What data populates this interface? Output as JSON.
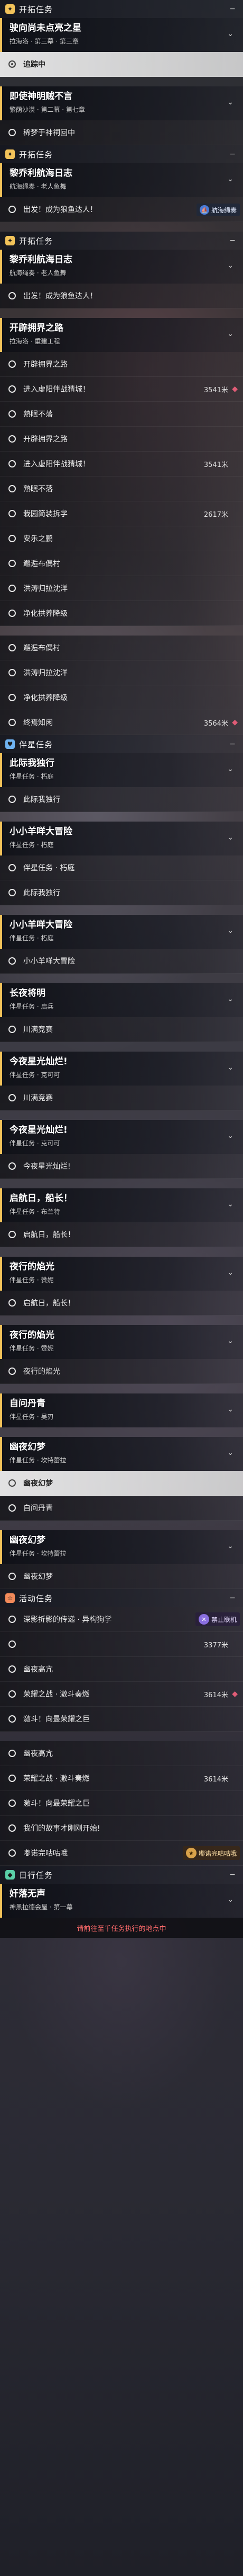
{
  "colors": {
    "main_badge": "#f2c35a",
    "trailblaze_badge": "#f2c35a",
    "companion_badge": "#6fb3f2",
    "event_badge": "#f28a5a",
    "daily_badge": "#5ad0a8",
    "marker": "#e05c76",
    "highlight_row": "#efefef"
  },
  "sections": [
    {
      "type": "cat",
      "badge": "✦",
      "badge_color": "#f2c35a",
      "title": "开拓任务",
      "toggle": "−"
    },
    {
      "type": "mission",
      "title": "驶向尚未点亮之星",
      "sub": "拉海洛 · 第三幕 · 第三章"
    },
    {
      "type": "obj",
      "text": "追踪中",
      "state": "hl",
      "done": true
    },
    {
      "type": "gap"
    },
    {
      "type": "mission",
      "title": "即使神明贼不言",
      "sub": "繁荫沙漠 · 第二幕 · 第七章"
    },
    {
      "type": "obj",
      "text": "稀梦于神祠回中",
      "done": false
    },
    {
      "type": "cat",
      "badge": "✦",
      "badge_color": "#f2c35a",
      "title": "开拓任务",
      "toggle": "−"
    },
    {
      "type": "mission",
      "title": "黎乔利航海日志",
      "sub": "航海绳奏 · 老人鱼舞"
    },
    {
      "type": "obj",
      "text": "出发！成为狼鱼达人！",
      "done": false,
      "tag": "航海绳奏"
    },
    {
      "type": "gap"
    },
    {
      "type": "cat",
      "badge": "✦",
      "badge_color": "#f2c35a",
      "title": "开拓任务",
      "toggle": "−"
    },
    {
      "type": "mission",
      "title": "黎乔利航海日志",
      "sub": "航海绳奏 · 老人鱼舞"
    },
    {
      "type": "obj",
      "text": "出发！成为狼鱼达人！",
      "done": false
    },
    {
      "type": "gap"
    },
    {
      "type": "mission",
      "title": "开辟拥界之路",
      "sub": "拉海洛 · 重建工程"
    },
    {
      "type": "obj",
      "text": "开辟拥界之路",
      "done": false
    },
    {
      "type": "obj",
      "text": "进入虚阳伴战猜城！",
      "dist": "3541米",
      "done": false,
      "marker": true
    },
    {
      "type": "obj",
      "text": "熟眠不落",
      "done": false
    },
    {
      "type": "obj",
      "text": "开辟拥界之路",
      "done": false
    },
    {
      "type": "obj",
      "text": "进入虚阳伴战猜城！",
      "dist": "3541米",
      "done": false
    },
    {
      "type": "obj",
      "text": "熟眠不落",
      "done": false
    },
    {
      "type": "obj",
      "text": "栽园简装拆学",
      "dist": "2617米",
      "done": false
    },
    {
      "type": "obj",
      "text": "安乐之鹏",
      "done": false
    },
    {
      "type": "obj",
      "text": "邂逅布偶村",
      "done": false
    },
    {
      "type": "obj",
      "text": "洪涛归拉沈洋",
      "done": false
    },
    {
      "type": "obj",
      "text": "净化拱养降级",
      "done": false
    },
    {
      "type": "gap"
    },
    {
      "type": "obj",
      "text": "邂逅布偶村",
      "done": false
    },
    {
      "type": "obj",
      "text": "洪涛归拉沈洋",
      "done": false
    },
    {
      "type": "obj",
      "text": "净化拱养降级",
      "done": false
    },
    {
      "type": "obj",
      "text": "终焉知闲",
      "dist": "3564米",
      "done": false,
      "marker": true
    },
    {
      "type": "cat",
      "badge": "♥",
      "badge_color": "#6fb3f2",
      "title": "伴星任务",
      "toggle": "−"
    },
    {
      "type": "mission",
      "title": "此际我独行",
      "sub": "伴星任务 · 朽庭"
    },
    {
      "type": "obj",
      "text": "此际我独行",
      "done": false
    },
    {
      "type": "gap"
    },
    {
      "type": "mission",
      "title": "小小羊咩大冒险",
      "sub": "伴星任务 · 朽庭"
    },
    {
      "type": "obj",
      "text": "伴星任务 · 朽庭",
      "done": false
    },
    {
      "type": "obj",
      "text": "此际我独行",
      "done": false
    },
    {
      "type": "gap"
    },
    {
      "type": "mission",
      "title": "小小羊咩大冒险",
      "sub": "伴星任务 · 朽庭"
    },
    {
      "type": "obj",
      "text": "小小羊咩大冒险",
      "done": false
    },
    {
      "type": "gap"
    },
    {
      "type": "mission",
      "title": "长夜将明",
      "sub": "伴星任务 · 启兵"
    },
    {
      "type": "obj",
      "text": "川满竞赛",
      "done": false
    },
    {
      "type": "gap"
    },
    {
      "type": "mission",
      "title": "今夜星光灿烂!",
      "sub": "伴星任务 · 克可可"
    },
    {
      "type": "obj",
      "text": "川满竞赛",
      "done": false
    },
    {
      "type": "gap"
    },
    {
      "type": "mission",
      "title": "今夜星光灿烂!",
      "sub": "伴星任务 · 克可可"
    },
    {
      "type": "obj",
      "text": "今夜星光灿烂!",
      "done": false
    },
    {
      "type": "gap"
    },
    {
      "type": "mission",
      "title": "启航日，船长！",
      "sub": "伴星任务 · 布兰特"
    },
    {
      "type": "obj",
      "text": "启航日，船长！",
      "done": false
    },
    {
      "type": "gap"
    },
    {
      "type": "mission",
      "title": "夜行的焰光",
      "sub": "伴星任务 · 赞妮"
    },
    {
      "type": "obj",
      "text": "启航日，船长！",
      "done": false
    },
    {
      "type": "gap"
    },
    {
      "type": "mission",
      "title": "夜行的焰光",
      "sub": "伴星任务 · 赞妮"
    },
    {
      "type": "obj",
      "text": "夜行的焰光",
      "done": false
    },
    {
      "type": "gap"
    },
    {
      "type": "mission",
      "title": "自问丹青",
      "sub": "伴星任务 · 吴刃"
    },
    {
      "type": "gap"
    },
    {
      "type": "mission",
      "title": "幽夜幻梦",
      "sub": "伴星任务 · 坎特蕾拉"
    },
    {
      "type": "obj",
      "text": "幽夜幻梦",
      "done": false,
      "state": "hl"
    },
    {
      "type": "obj",
      "text": "自问丹青",
      "done": false
    },
    {
      "type": "gap"
    },
    {
      "type": "mission",
      "title": "幽夜幻梦",
      "sub": "伴星任务 · 坎特蕾拉"
    },
    {
      "type": "obj",
      "text": "幽夜幻梦",
      "done": false
    },
    {
      "type": "cat",
      "badge": "☆",
      "badge_color": "#f28a5a",
      "title": "活动任务",
      "toggle": "−"
    },
    {
      "type": "obj",
      "text": "深影折影的传递 · 异构狗学",
      "done": false,
      "tag2": "禁止联机"
    },
    {
      "type": "obj",
      "text": "",
      "dist": "3377米",
      "done": false
    },
    {
      "type": "obj",
      "text": "幽夜高亢",
      "done": false
    },
    {
      "type": "obj",
      "text": "荣耀之战 · 激斗奏燃",
      "dist": "3614米",
      "done": false,
      "marker": true
    },
    {
      "type": "obj",
      "text": "激斗！向最荣耀之巨",
      "done": false
    },
    {
      "type": "gap"
    },
    {
      "type": "obj",
      "text": "幽夜高亢",
      "done": false
    },
    {
      "type": "obj",
      "text": "荣耀之战 · 激斗奏燃",
      "dist": "3614米",
      "done": false
    },
    {
      "type": "obj",
      "text": "激斗！向最荣耀之巨",
      "done": false
    },
    {
      "type": "obj",
      "text": "我们的故事才刚刚开始!",
      "done": false
    },
    {
      "type": "obj",
      "text": "嘟诺完咕咕哦",
      "done": false,
      "tag3": "嘟诺完咕咕哦"
    },
    {
      "type": "cat",
      "badge": "◆",
      "badge_color": "#5ad0a8",
      "title": "日行任务",
      "toggle": "−"
    },
    {
      "type": "mission",
      "title": "奸落无声",
      "sub": "神黑拉德会屋 · 第一幕"
    },
    {
      "type": "note",
      "text": "请前往至千任务执行的地点中"
    }
  ]
}
